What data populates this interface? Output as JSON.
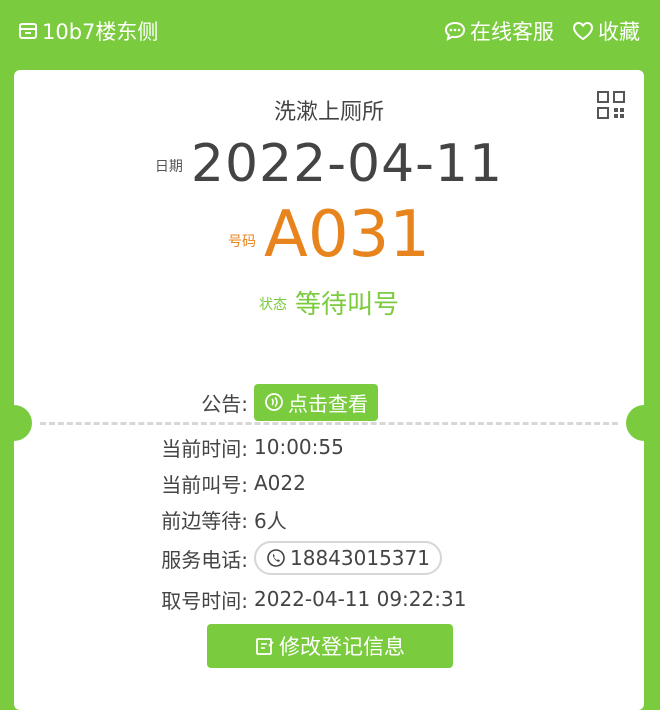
{
  "header": {
    "location": "10b7楼东侧",
    "service_label": "在线客服",
    "favorite_label": "收藏"
  },
  "ticket": {
    "title": "洗漱上厕所",
    "date_label": "日期",
    "date_value": "2022-04-11",
    "number_label": "号码",
    "number_value": "A031",
    "status_label": "状态",
    "status_value": "等待叫号"
  },
  "details": {
    "notice_label": "公告:",
    "notice_button": "点击查看",
    "current_time_label": "当前时间:",
    "current_time_value": "10:00:55",
    "current_call_label": "当前叫号:",
    "current_call_value": "A022",
    "waiting_label": "前边等待:",
    "waiting_value": "6人",
    "phone_label": "服务电话:",
    "phone_value": "18843015371",
    "take_time_label": "取号时间:",
    "take_time_value": "2022-04-11 09:22:31"
  },
  "edit_button": "修改登记信息",
  "colors": {
    "brand_green": "#7ACB3D",
    "number_orange": "#E8841E"
  },
  "icons": [
    "store-icon",
    "chat-icon",
    "heart-icon",
    "qr-code-icon",
    "sound-icon",
    "phone-icon",
    "edit-icon"
  ]
}
